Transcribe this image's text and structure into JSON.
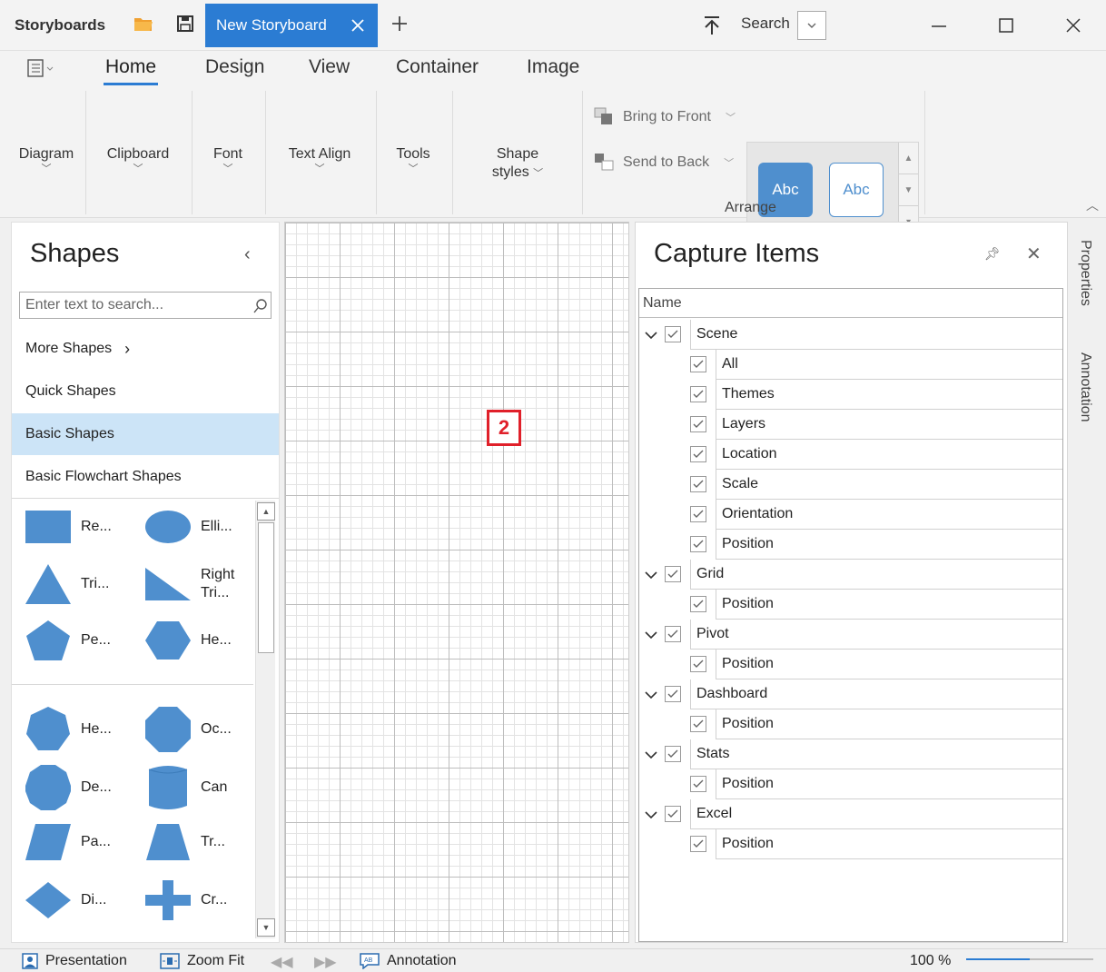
{
  "titlebar": {
    "app_title": "Storyboards",
    "document_tab": "New Storyboard",
    "search_label": "Search",
    "colors": {
      "accent": "#2b7cd3",
      "folder": "#f0a030"
    }
  },
  "ribbon": {
    "tabs": [
      {
        "label": "Home",
        "active": true
      },
      {
        "label": "Design"
      },
      {
        "label": "View"
      },
      {
        "label": "Container"
      },
      {
        "label": "Image"
      }
    ],
    "groups": {
      "diagram": "Diagram",
      "clipboard": "Clipboard",
      "font": "Font",
      "text_align": "Text Align",
      "tools": "Tools",
      "shape_styles_1": "Shape",
      "shape_styles_2": "styles"
    },
    "arrange": {
      "bring_to_front": "Bring to Front",
      "send_to_back": "Send to Back",
      "style_1": "Abc",
      "style_2": "Abc",
      "label": "Arrange"
    }
  },
  "shapes": {
    "title": "Shapes",
    "search_placeholder": "Enter text to search...",
    "categories": [
      {
        "label": "More Shapes"
      },
      {
        "label": "Quick Shapes"
      },
      {
        "label": "Basic Shapes",
        "selected": true
      },
      {
        "label": "Basic Flowchart Shapes"
      }
    ],
    "items": [
      {
        "label": "Re...",
        "icon": "rectangle-shape-icon"
      },
      {
        "label": "Elli...",
        "icon": "ellipse-shape-icon"
      },
      {
        "label": "Tri...",
        "icon": "triangle-shape-icon"
      },
      {
        "label_1": "Right",
        "label_2": "Tri...",
        "icon": "right-triangle-shape-icon"
      },
      {
        "label": "Pe...",
        "icon": "pentagon-shape-icon"
      },
      {
        "label": "He...",
        "icon": "hexagon-shape-icon"
      },
      {
        "label": "He...",
        "icon": "heptagon-shape-icon"
      },
      {
        "label": "Oc...",
        "icon": "octagon-shape-icon"
      },
      {
        "label": "De...",
        "icon": "decagon-shape-icon"
      },
      {
        "label": "Can",
        "icon": "can-shape-icon"
      },
      {
        "label": "Pa...",
        "icon": "parallelogram-shape-icon"
      },
      {
        "label": "Tr...",
        "icon": "trapezoid-shape-icon"
      },
      {
        "label": "Di...",
        "icon": "diamond-shape-icon"
      },
      {
        "label": "Cr...",
        "icon": "cross-shape-icon"
      }
    ],
    "shape_color": "#4f8fce"
  },
  "canvas": {
    "badge": "2",
    "badge_color": "#e0202a"
  },
  "capture": {
    "title": "Capture Items",
    "column_name": "Name",
    "rows": [
      {
        "label": "Scene",
        "level": 0
      },
      {
        "label": "All",
        "level": 1
      },
      {
        "label": "Themes",
        "level": 1
      },
      {
        "label": "Layers",
        "level": 1
      },
      {
        "label": "Location",
        "level": 1
      },
      {
        "label": "Scale",
        "level": 1
      },
      {
        "label": "Orientation",
        "level": 1
      },
      {
        "label": "Position",
        "level": 1
      },
      {
        "label": "Grid",
        "level": 0
      },
      {
        "label": "Position",
        "level": 1
      },
      {
        "label": "Pivot",
        "level": 0
      },
      {
        "label": "Position",
        "level": 1
      },
      {
        "label": "Dashboard",
        "level": 0
      },
      {
        "label": "Position",
        "level": 1
      },
      {
        "label": "Stats",
        "level": 0
      },
      {
        "label": "Position",
        "level": 1
      },
      {
        "label": "Excel",
        "level": 0
      },
      {
        "label": "Position",
        "level": 1
      }
    ]
  },
  "side_tabs": {
    "properties": "Properties",
    "annotation": "Annotation"
  },
  "statusbar": {
    "presentation": "Presentation",
    "zoom_fit": "Zoom Fit",
    "annotation": "Annotation",
    "zoom_level": "100 %",
    "zoom_fraction": 0.5
  }
}
